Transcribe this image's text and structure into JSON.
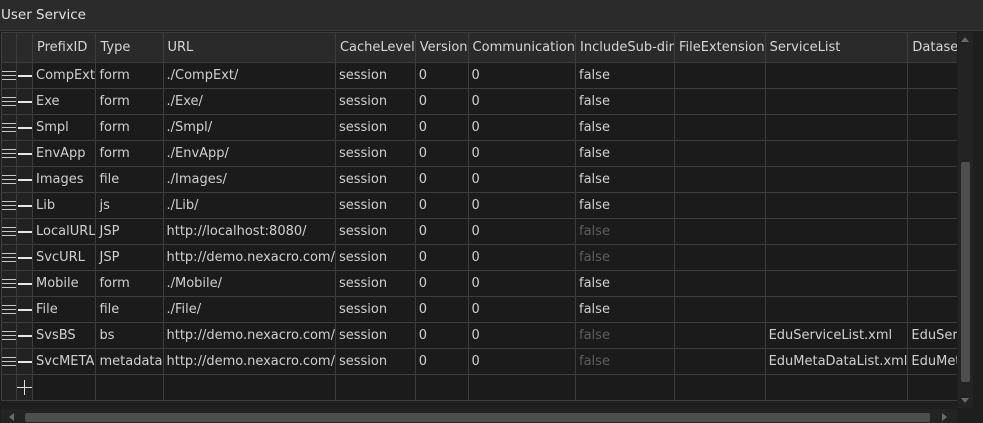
{
  "window": {
    "title": "User Service"
  },
  "columns": [
    "PrefixID",
    "Type",
    "URL",
    "CacheLevel",
    "Version",
    "Communication",
    "IncludeSub-dir",
    "FileExtension",
    "ServiceList",
    "DatasetLayout"
  ],
  "rows": [
    {
      "prefix": "CompExt",
      "type": "form",
      "url": "./CompExt/",
      "cache": "session",
      "version": "0",
      "comm": "0",
      "includesub": "false",
      "includesub_dim": false,
      "fileext": "",
      "servicelist": "",
      "datasetlayout": ""
    },
    {
      "prefix": "Exe",
      "type": "form",
      "url": "./Exe/",
      "cache": "session",
      "version": "0",
      "comm": "0",
      "includesub": "false",
      "includesub_dim": false,
      "fileext": "",
      "servicelist": "",
      "datasetlayout": ""
    },
    {
      "prefix": "Smpl",
      "type": "form",
      "url": "./Smpl/",
      "cache": "session",
      "version": "0",
      "comm": "0",
      "includesub": "false",
      "includesub_dim": false,
      "fileext": "",
      "servicelist": "",
      "datasetlayout": ""
    },
    {
      "prefix": "EnvApp",
      "type": "form",
      "url": "./EnvApp/",
      "cache": "session",
      "version": "0",
      "comm": "0",
      "includesub": "false",
      "includesub_dim": false,
      "fileext": "",
      "servicelist": "",
      "datasetlayout": ""
    },
    {
      "prefix": "Images",
      "type": "file",
      "url": "./Images/",
      "cache": "session",
      "version": "0",
      "comm": "0",
      "includesub": "false",
      "includesub_dim": false,
      "fileext": "",
      "servicelist": "",
      "datasetlayout": ""
    },
    {
      "prefix": "Lib",
      "type": "js",
      "url": "./Lib/",
      "cache": "session",
      "version": "0",
      "comm": "0",
      "includesub": "false",
      "includesub_dim": false,
      "fileext": "",
      "servicelist": "",
      "datasetlayout": ""
    },
    {
      "prefix": "LocalURL",
      "type": "JSP",
      "url": "http://localhost:8080/",
      "cache": "session",
      "version": "0",
      "comm": "0",
      "includesub": "false",
      "includesub_dim": true,
      "fileext": "",
      "servicelist": "",
      "datasetlayout": ""
    },
    {
      "prefix": "SvcURL",
      "type": "JSP",
      "url": "http://demo.nexacro.com/",
      "cache": "session",
      "version": "0",
      "comm": "0",
      "includesub": "false",
      "includesub_dim": true,
      "fileext": "",
      "servicelist": "",
      "datasetlayout": ""
    },
    {
      "prefix": "Mobile",
      "type": "form",
      "url": "./Mobile/",
      "cache": "session",
      "version": "0",
      "comm": "0",
      "includesub": "false",
      "includesub_dim": false,
      "fileext": "",
      "servicelist": "",
      "datasetlayout": ""
    },
    {
      "prefix": "File",
      "type": "file",
      "url": "./File/",
      "cache": "session",
      "version": "0",
      "comm": "0",
      "includesub": "false",
      "includesub_dim": false,
      "fileext": "",
      "servicelist": "",
      "datasetlayout": ""
    },
    {
      "prefix": "SvsBS",
      "type": "bs",
      "url": "http://demo.nexacro.com/",
      "cache": "session",
      "version": "0",
      "comm": "0",
      "includesub": "false",
      "includesub_dim": true,
      "fileext": "",
      "servicelist": "EduServiceList.xml",
      "datasetlayout": "EduServiceLayout"
    },
    {
      "prefix": "SvcMETA",
      "type": "metadata",
      "url": "http://demo.nexacro.com/",
      "cache": "session",
      "version": "0",
      "comm": "0",
      "includesub": "false",
      "includesub_dim": true,
      "fileext": "",
      "servicelist": "EduMetaDataList.xml",
      "datasetlayout": "EduMetaDataLayout"
    }
  ],
  "icons": {
    "row_handle": "drag-handle-icon",
    "remove": "minus-icon",
    "add": "plus-icon"
  }
}
